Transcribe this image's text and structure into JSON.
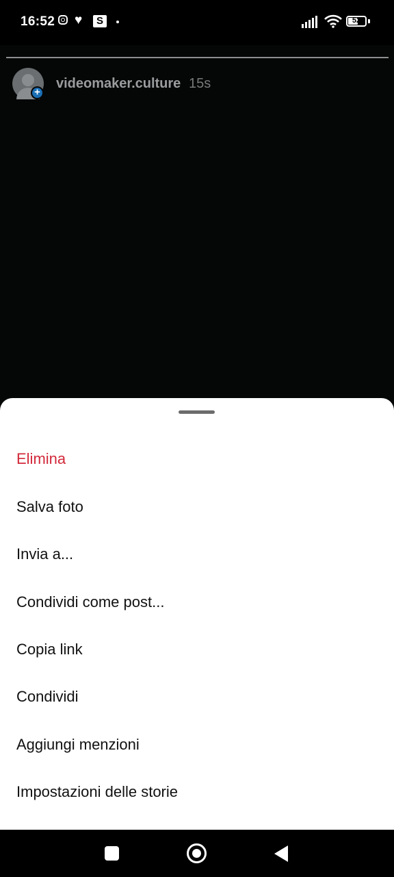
{
  "status_bar": {
    "time": "16:52",
    "notification_letter": "S",
    "battery": "52"
  },
  "story": {
    "username": "videomaker.culture",
    "timestamp": "15s"
  },
  "sheet": {
    "items": [
      {
        "label": "Elimina",
        "danger": true
      },
      {
        "label": "Salva foto"
      },
      {
        "label": "Invia a..."
      },
      {
        "label": "Condividi come post..."
      },
      {
        "label": "Copia link"
      },
      {
        "label": "Condividi"
      },
      {
        "label": "Aggiungi menzioni"
      },
      {
        "label": "Impostazioni delle storie"
      }
    ]
  },
  "colors": {
    "danger": "#d2283a",
    "accent_badge": "#1a6fb5"
  }
}
